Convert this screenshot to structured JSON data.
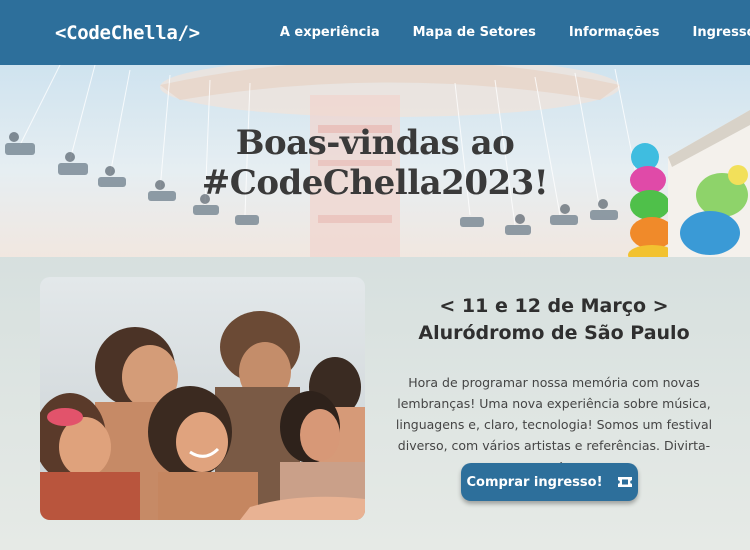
{
  "header": {
    "logo": "<CodeChella/>",
    "nav": [
      "A experiência",
      "Mapa de Setores",
      "Informações",
      "Ingresso"
    ]
  },
  "hero": {
    "title_line1": "Boas-vindas ao",
    "title_line2": "#CodeChella2023!"
  },
  "event": {
    "date": "< 11 e 12 de Março >",
    "place": "Aluródromo de São Paulo",
    "description": "Hora de programar nossa memória com novas lembranças! Uma nova experiência sobre música, linguagens e, claro, tecnologia! Somos um festival diverso, com vários artistas e referências. Divirta-se!",
    "buy_label": "Comprar ingresso!",
    "buy_icon": "ticket-icon"
  },
  "colors": {
    "header_bg": "#2d6f9b",
    "button_bg": "#2d6f9b",
    "page_bg": "#dfe5e3"
  }
}
